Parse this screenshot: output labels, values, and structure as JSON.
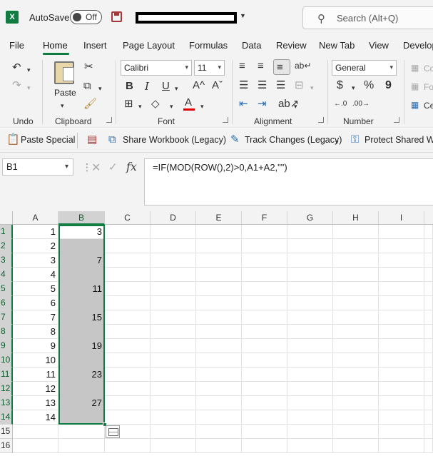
{
  "titlebar": {
    "autosave_label": "AutoSave",
    "autosave_state": "Off",
    "search_placeholder": "Search (Alt+Q)"
  },
  "tabs": [
    "File",
    "Home",
    "Insert",
    "Page Layout",
    "Formulas",
    "Data",
    "Review",
    "New Tab",
    "View",
    "Develop"
  ],
  "active_tab": "Home",
  "ribbon": {
    "clipboard": {
      "paste_label": "Paste",
      "group_label": "Clipboard"
    },
    "undo": {
      "group_label": "Undo"
    },
    "font": {
      "name": "Calibri",
      "size": "11",
      "group_label": "Font",
      "bold": "B",
      "italic": "I",
      "underline": "U",
      "font_color": "A",
      "grow": "A^",
      "shrink": "Aˇ"
    },
    "alignment": {
      "group_label": "Alignment"
    },
    "number": {
      "format": "General",
      "group_label": "Number",
      "currency": "$",
      "percent": "%",
      "comma": "9"
    },
    "styles": {
      "conditional": "Co",
      "format_as": "Fo",
      "cell_styles": "Ce"
    },
    "colors": {
      "accent": "#107c41",
      "font_color_bar": "#e00000"
    }
  },
  "quickbar": {
    "paste_special": "Paste Special",
    "share_workbook": "Share Workbook (Legacy)",
    "track_changes": "Track Changes (Legacy)",
    "protect_shared": "Protect Shared Wo"
  },
  "formula_bar": {
    "name_box": "B1",
    "formula": "=IF(MOD(ROW(),2)>0,A1+A2,\"\")"
  },
  "grid": {
    "columns": [
      "A",
      "B",
      "C",
      "D",
      "E",
      "F",
      "G",
      "H",
      "I"
    ],
    "selected_column": "B",
    "rows": [
      "1",
      "2",
      "3",
      "4",
      "5",
      "6",
      "7",
      "8",
      "9",
      "10",
      "11",
      "12",
      "13",
      "14",
      "15",
      "16"
    ],
    "col_a": [
      "1",
      "2",
      "3",
      "4",
      "5",
      "6",
      "7",
      "8",
      "9",
      "10",
      "11",
      "12",
      "13",
      "14",
      "",
      ""
    ],
    "col_b": [
      "3",
      "",
      "7",
      "",
      "11",
      "",
      "15",
      "",
      "19",
      "",
      "23",
      "",
      "27",
      "",
      "",
      ""
    ]
  }
}
